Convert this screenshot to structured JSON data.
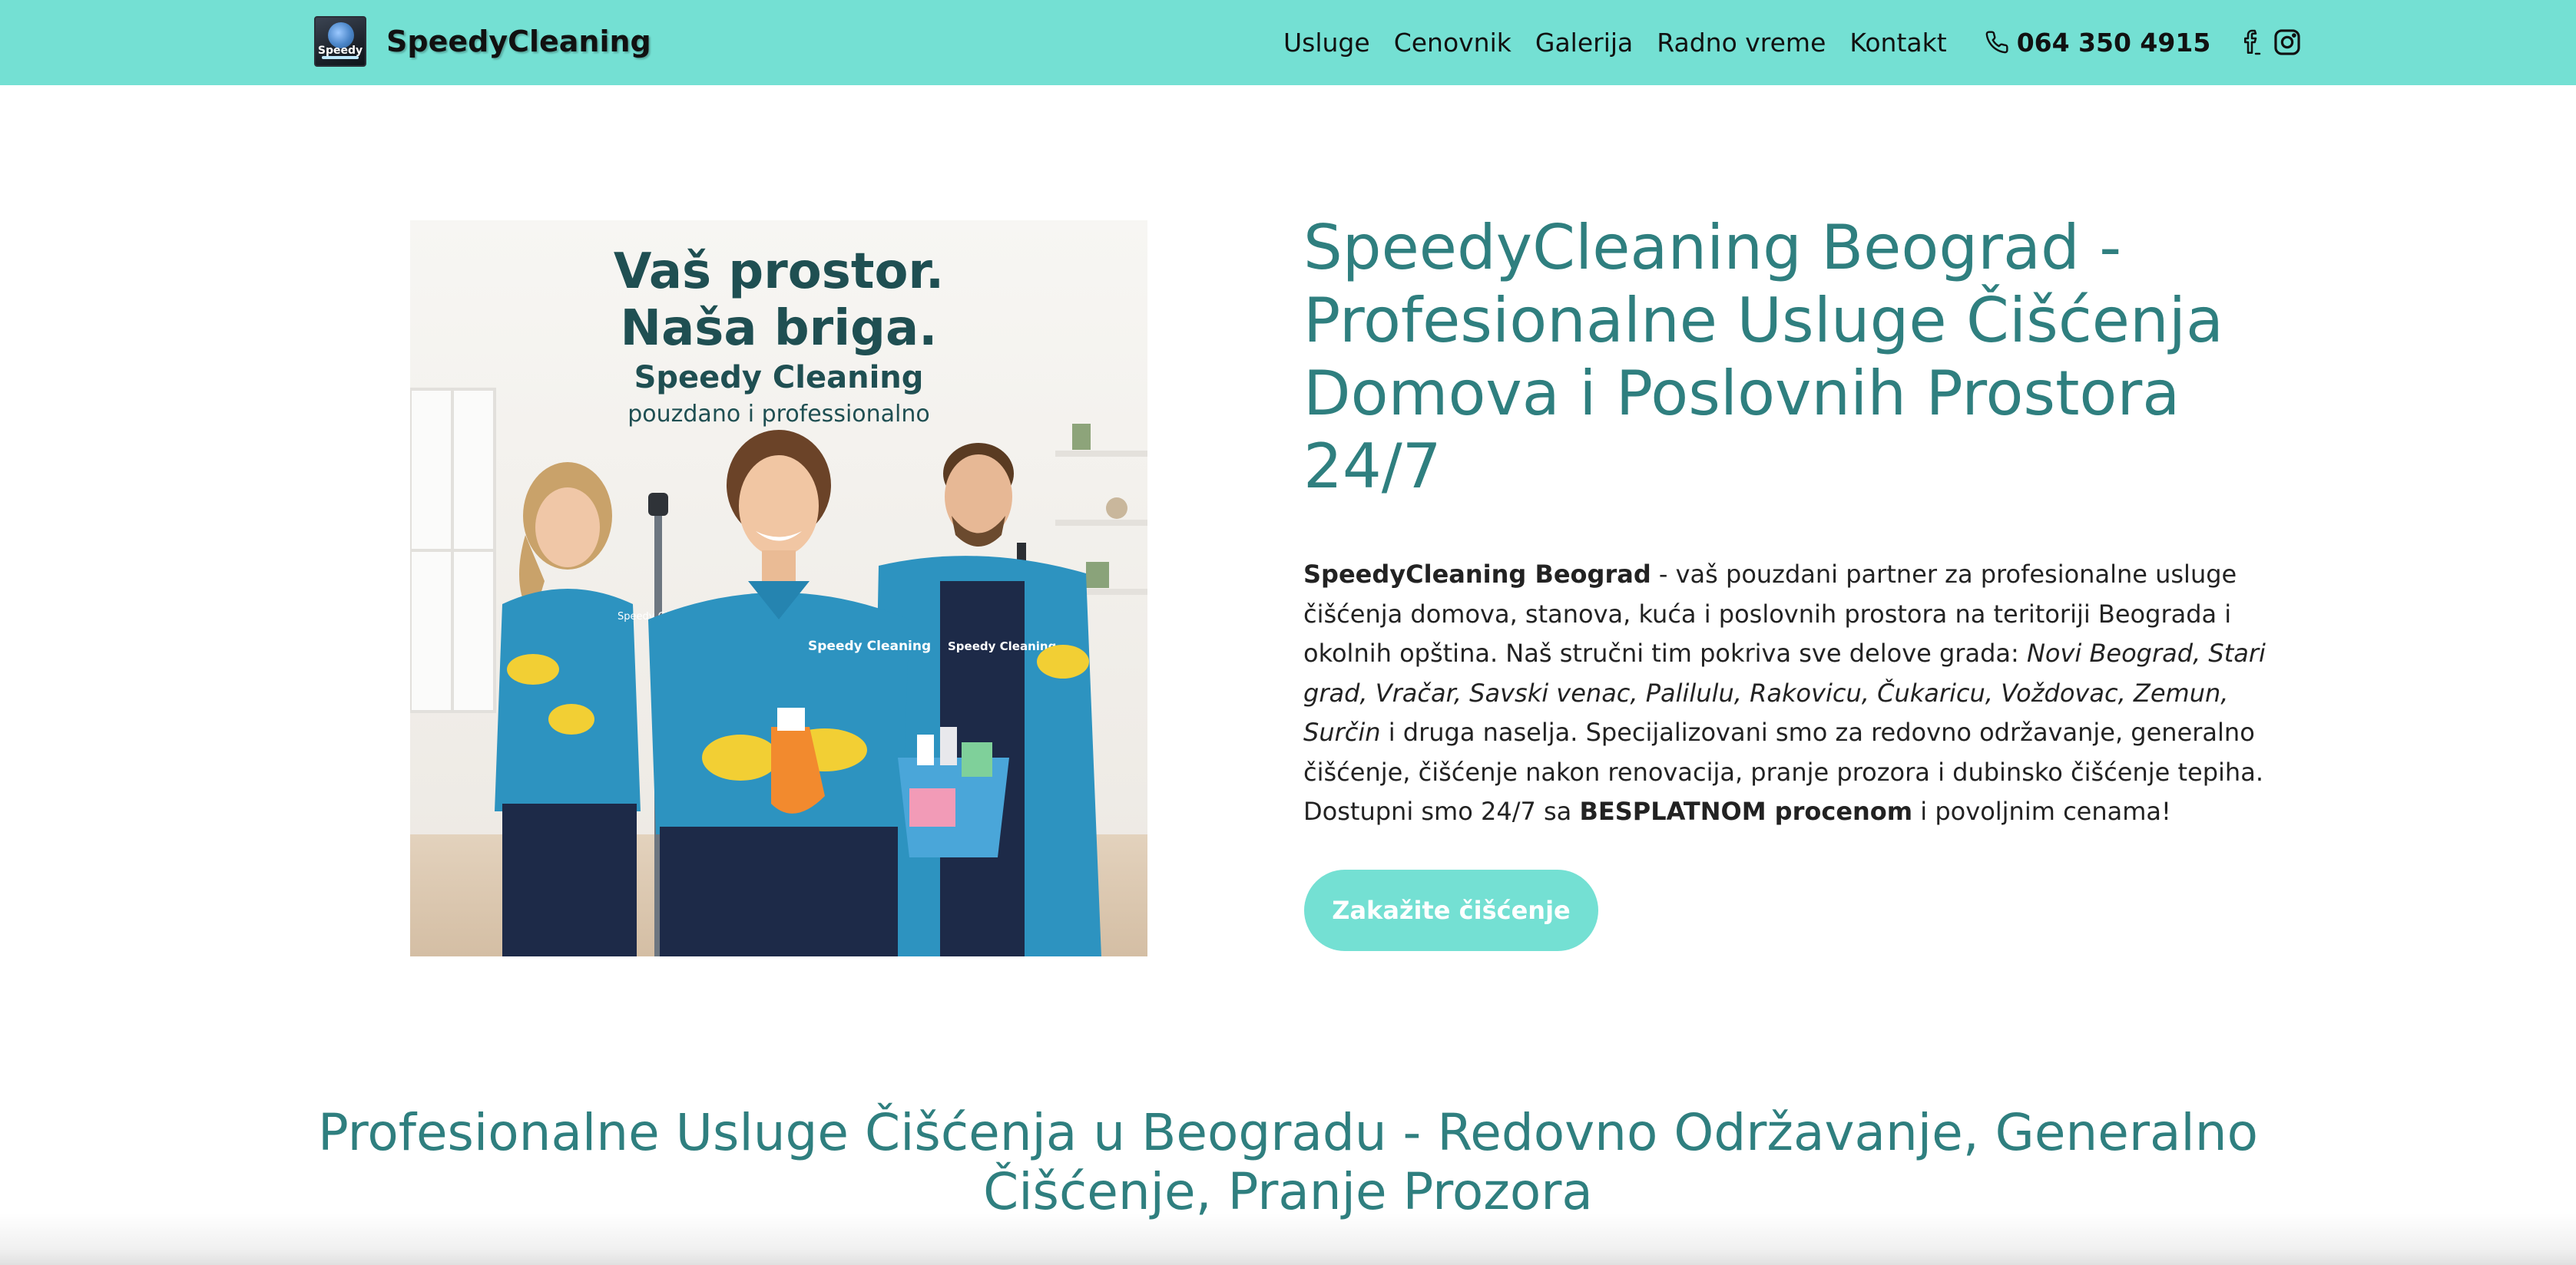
{
  "header": {
    "brand": "SpeedyCleaning",
    "logo_text": "Speedy",
    "nav": [
      "Usluge",
      "Cenovnik",
      "Galerija",
      "Radno vreme",
      "Kontakt"
    ],
    "phone": "064 350 4915",
    "social_icons": [
      "facebook-icon",
      "instagram-icon"
    ],
    "background_color": "#74e0d3"
  },
  "hero": {
    "image": {
      "headline_line1": "Vaš prostor.",
      "headline_line2": "Naša briga.",
      "brand": "Speedy Cleaning",
      "tagline": "pouzdano i professionalno",
      "shirt_text": "Speedy Cleaning"
    },
    "title": "SpeedyCleaning Beograd - Profesionalne Usluge Čišćenja Domova i Poslovnih Prostora 24/7",
    "text": {
      "brand_bold": "SpeedyCleaning Beograd",
      "part1": " - vaš pouzdani partner za profesionalne usluge čišćenja domova, stanova, kuća i poslovnih prostora na teritoriji Beograda i okolnih opština. Naš stručni tim pokriva sve delove grada: ",
      "areas_italic": "Novi Beograd, Stari grad, Vračar, Savski venac, Palilulu, Rakovicu, Čukaricu, Voždovac, Zemun, Surčin",
      "part2": " i druga naselja. Specijalizovani smo za redovno održavanje, generalno čišćenje, čišćenje nakon renovacija, pranje prozora i dubinsko čišćenje tepiha. Dostupni smo 24/7 sa ",
      "estimate_bold": "BESPLATNOM procenom",
      "part3": " i povoljnim cenama!"
    },
    "cta": "Zakažite čišćenje",
    "title_color": "#2f7f7f",
    "button_color": "#74e0d3"
  },
  "services": {
    "heading": "Profesionalne Usluge Čišćenja u Beogradu - Redovno Održavanje, Generalno Čišćenje, Pranje Prozora"
  }
}
